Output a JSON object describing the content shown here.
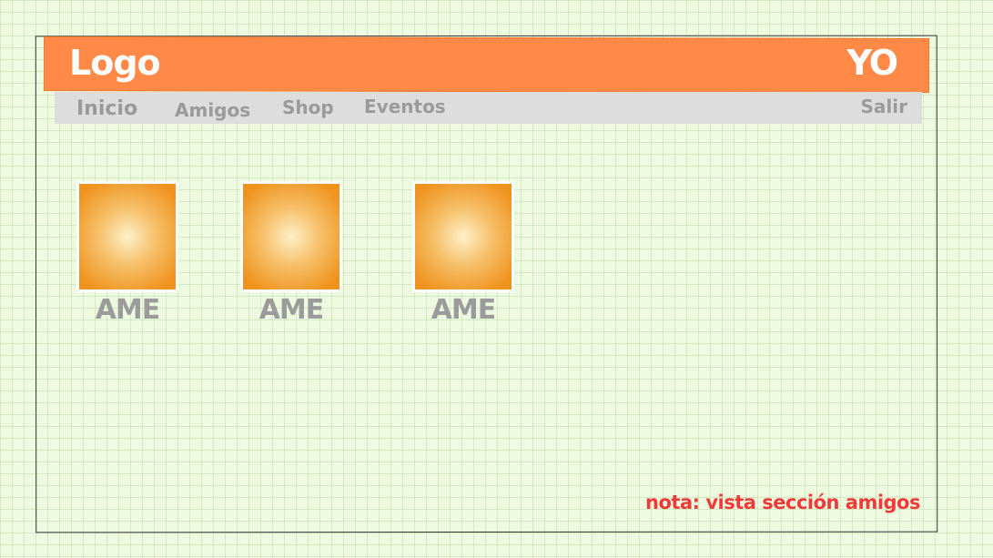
{
  "header": {
    "logo": "Logo",
    "user": "YO"
  },
  "nav": {
    "items": [
      {
        "label": "Inicio"
      },
      {
        "label": "Amigos"
      },
      {
        "label": "Shop"
      },
      {
        "label": "Eventos"
      }
    ],
    "logout": "Salir"
  },
  "friends": [
    {
      "name": "AME"
    },
    {
      "name": "AME"
    },
    {
      "name": "AME"
    }
  ],
  "note": "nota: vista  sección amigos",
  "colors": {
    "header": "#ff8a48",
    "navbar": "#dddddd",
    "photo": "#ef9420",
    "note": "#f03a3a",
    "label": "#9b9b9b"
  }
}
